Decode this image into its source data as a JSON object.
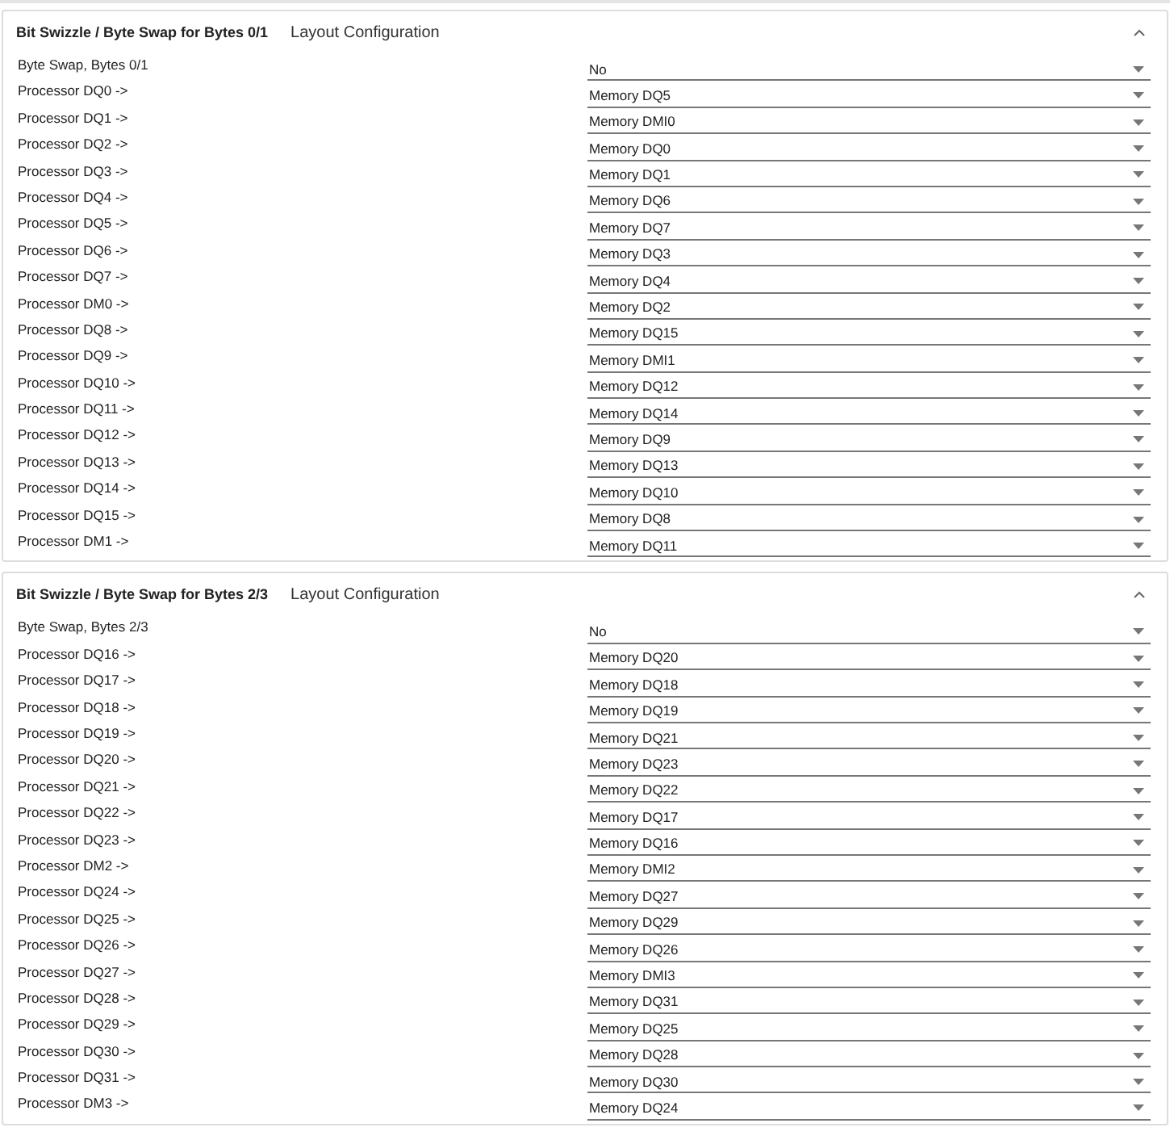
{
  "sections": [
    {
      "title": "Bit Swizzle / Byte Swap for Bytes 0/1",
      "subtitle": "Layout Configuration",
      "expanded": true,
      "rows": [
        {
          "label": "Byte Swap, Bytes 0/1",
          "value": "No"
        },
        {
          "label": "Processor DQ0 ->",
          "value": "Memory DQ5"
        },
        {
          "label": "Processor DQ1 ->",
          "value": "Memory DMI0"
        },
        {
          "label": "Processor DQ2 ->",
          "value": "Memory DQ0"
        },
        {
          "label": "Processor DQ3 ->",
          "value": "Memory DQ1"
        },
        {
          "label": "Processor DQ4 ->",
          "value": "Memory DQ6"
        },
        {
          "label": "Processor DQ5 ->",
          "value": "Memory DQ7"
        },
        {
          "label": "Processor DQ6 ->",
          "value": "Memory DQ3"
        },
        {
          "label": "Processor DQ7 ->",
          "value": "Memory DQ4"
        },
        {
          "label": "Processor DM0 ->",
          "value": "Memory DQ2"
        },
        {
          "label": "Processor DQ8 ->",
          "value": "Memory DQ15"
        },
        {
          "label": "Processor DQ9 ->",
          "value": "Memory DMI1"
        },
        {
          "label": "Processor DQ10 ->",
          "value": "Memory DQ12"
        },
        {
          "label": "Processor DQ11 ->",
          "value": "Memory DQ14"
        },
        {
          "label": "Processor DQ12 ->",
          "value": "Memory DQ9"
        },
        {
          "label": "Processor DQ13 ->",
          "value": "Memory DQ13"
        },
        {
          "label": "Processor DQ14 ->",
          "value": "Memory DQ10"
        },
        {
          "label": "Processor DQ15 ->",
          "value": "Memory DQ8"
        },
        {
          "label": "Processor DM1 ->",
          "value": "Memory DQ11"
        }
      ]
    },
    {
      "title": "Bit Swizzle / Byte Swap for Bytes 2/3",
      "subtitle": "Layout Configuration",
      "expanded": true,
      "rows": [
        {
          "label": "Byte Swap, Bytes 2/3",
          "value": "No"
        },
        {
          "label": "Processor DQ16 ->",
          "value": "Memory DQ20"
        },
        {
          "label": "Processor DQ17 ->",
          "value": "Memory DQ18"
        },
        {
          "label": "Processor DQ18 ->",
          "value": "Memory DQ19"
        },
        {
          "label": "Processor DQ19 ->",
          "value": "Memory DQ21"
        },
        {
          "label": "Processor DQ20 ->",
          "value": "Memory DQ23"
        },
        {
          "label": "Processor DQ21 ->",
          "value": "Memory DQ22"
        },
        {
          "label": "Processor DQ22 ->",
          "value": "Memory DQ17"
        },
        {
          "label": "Processor DQ23 ->",
          "value": "Memory DQ16"
        },
        {
          "label": "Processor DM2 ->",
          "value": "Memory DMI2"
        },
        {
          "label": "Processor DQ24 ->",
          "value": "Memory DQ27"
        },
        {
          "label": "Processor DQ25 ->",
          "value": "Memory DQ29"
        },
        {
          "label": "Processor DQ26 ->",
          "value": "Memory DQ26"
        },
        {
          "label": "Processor DQ27 ->",
          "value": "Memory DMI3"
        },
        {
          "label": "Processor DQ28 ->",
          "value": "Memory DQ31"
        },
        {
          "label": "Processor DQ29 ->",
          "value": "Memory DQ25"
        },
        {
          "label": "Processor DQ30 ->",
          "value": "Memory DQ28"
        },
        {
          "label": "Processor DQ31 ->",
          "value": "Memory DQ30"
        },
        {
          "label": "Processor DM3 ->",
          "value": "Memory DQ24"
        }
      ]
    }
  ]
}
